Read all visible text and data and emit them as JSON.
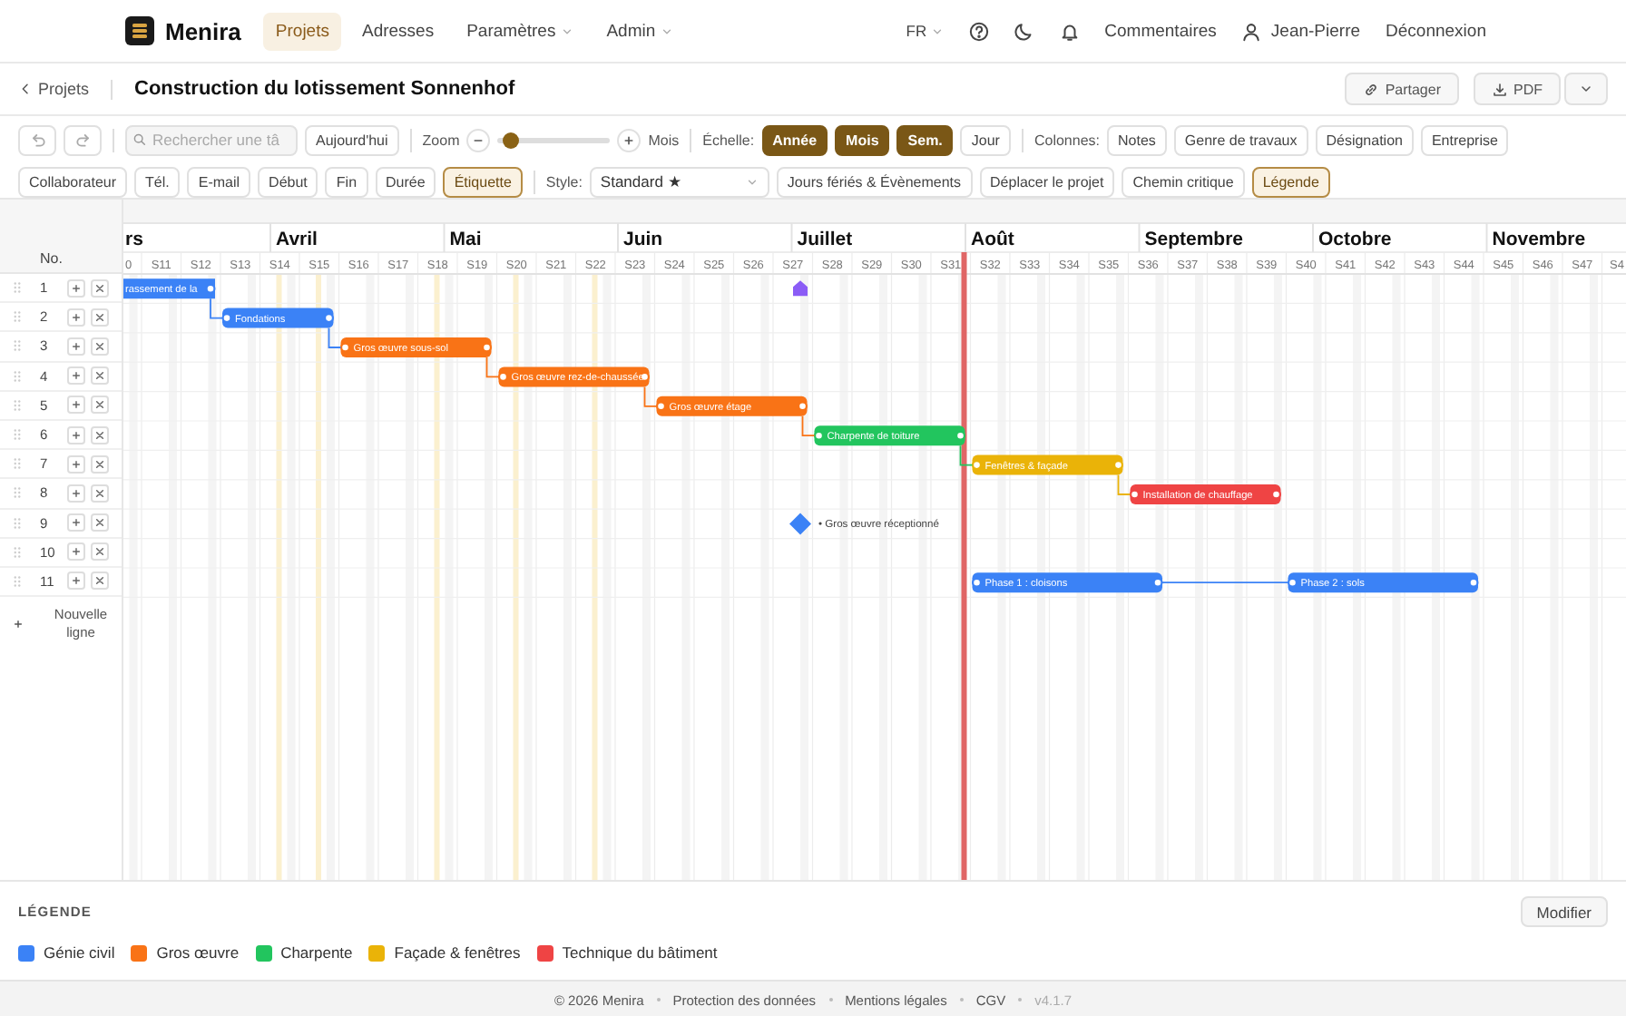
{
  "nav": {
    "brand": "Menira",
    "items": [
      {
        "label": "Projets",
        "selected": true,
        "menu": false
      },
      {
        "label": "Adresses",
        "selected": false,
        "menu": false
      },
      {
        "label": "Paramètres",
        "selected": false,
        "menu": true
      },
      {
        "label": "Admin",
        "selected": false,
        "menu": true
      }
    ],
    "language": "FR",
    "comments": "Commentaires",
    "user": "Jean-Pierre",
    "logout": "Déconnexion"
  },
  "project": {
    "back": "Projets",
    "title": "Construction du lotissement Sonnenhof",
    "actions": [
      {
        "kind": "share",
        "label": "Partager"
      },
      {
        "kind": "download",
        "label": "PDF"
      }
    ]
  },
  "toolbar": {
    "search": {
      "placeholder": "Rechercher une tâ"
    },
    "today": "Aujourd'hui",
    "zoom": {
      "label": "Zoom",
      "level": 0.05,
      "unit": "Mois"
    },
    "scale": {
      "label": "Échelle:",
      "options": [
        {
          "label": "Année",
          "selected": true
        },
        {
          "label": "Mois",
          "selected": true
        },
        {
          "label": "Sem.",
          "selected": true
        },
        {
          "label": "Jour",
          "selected": false
        }
      ]
    },
    "columns": {
      "label": "Colonnes:",
      "options": [
        {
          "label": "Notes",
          "on": false
        },
        {
          "label": "Genre de travaux",
          "on": false
        },
        {
          "label": "Désignation",
          "on": false
        },
        {
          "label": "Entreprise",
          "on": false
        }
      ]
    },
    "fields": [
      {
        "label": "Collaborateur",
        "on": false
      },
      {
        "label": "Tél.",
        "on": false
      },
      {
        "label": "E-mail",
        "on": false
      },
      {
        "label": "Début",
        "on": false
      },
      {
        "label": "Fin",
        "on": false
      },
      {
        "label": "Durée",
        "on": false
      },
      {
        "label": "Étiquette",
        "on": true
      }
    ],
    "style": {
      "label": "Style:",
      "value": "Standard ★"
    },
    "actions": [
      {
        "label": "Jours fériés & Évènements",
        "on": false
      },
      {
        "label": "Déplacer le projet",
        "on": false
      },
      {
        "label": "Chemin critique",
        "on": false
      },
      {
        "label": "Légende",
        "on": true
      }
    ]
  },
  "gantt": {
    "number_header": "No.",
    "months": [
      "rs",
      "Avril",
      "Mai",
      "Juin",
      "Juillet",
      "Août",
      "Septembre",
      "Octobre",
      "Novembre"
    ],
    "weeks": [
      "0",
      "S11",
      "S12",
      "S13",
      "S14",
      "S15",
      "S16",
      "S17",
      "S18",
      "S19",
      "S20",
      "S21",
      "S22",
      "S23",
      "S24",
      "S25",
      "S26",
      "S27",
      "S28",
      "S29",
      "S30",
      "S31",
      "S32",
      "S33",
      "S34",
      "S35",
      "S36",
      "S37",
      "S38",
      "S39",
      "S40",
      "S41",
      "S42",
      "S43",
      "S44",
      "S45",
      "S46",
      "S47",
      "S4"
    ],
    "rows": [
      {
        "number": "1",
        "items": [
          {
            "kind": "bar",
            "label": "rassement de la",
            "color": "#3b82f6",
            "linked": true
          },
          {
            "kind": "marker",
            "color": "#8b5cf6"
          }
        ]
      },
      {
        "number": "2",
        "items": [
          {
            "kind": "bar",
            "label": "Fondations",
            "color": "#3b82f6",
            "linked": true
          }
        ]
      },
      {
        "number": "3",
        "items": [
          {
            "kind": "bar",
            "label": "Gros œuvre sous-sol",
            "color": "#f97316",
            "linked": true
          }
        ]
      },
      {
        "number": "4",
        "items": [
          {
            "kind": "bar",
            "label": "Gros œuvre rez-de-chaussée",
            "color": "#f97316",
            "linked": true
          }
        ]
      },
      {
        "number": "5",
        "items": [
          {
            "kind": "bar",
            "label": "Gros œuvre étage",
            "color": "#f97316",
            "linked": true
          }
        ]
      },
      {
        "number": "6",
        "items": [
          {
            "kind": "bar",
            "label": "Charpente de toiture",
            "color": "#22c55e",
            "linked": true
          }
        ]
      },
      {
        "number": "7",
        "items": [
          {
            "kind": "bar",
            "label": "Fenêtres & façade",
            "color": "#eab308",
            "linked": true
          }
        ]
      },
      {
        "number": "8",
        "items": [
          {
            "kind": "bar",
            "label": "Installation de chauffage",
            "color": "#ef4444",
            "linked": false
          }
        ]
      },
      {
        "number": "9",
        "items": [
          {
            "kind": "milestone",
            "label": "• Gros œuvre réceptionné",
            "color": "#3b82f6"
          }
        ]
      },
      {
        "number": "10",
        "items": []
      },
      {
        "number": "11",
        "items": [
          {
            "kind": "bar",
            "label": "Phase 1 : cloisons",
            "color": "#3b82f6",
            "linked": true
          },
          {
            "kind": "bar",
            "label": "Phase 2 : sols",
            "color": "#3b82f6"
          }
        ]
      }
    ],
    "new_row": "Nouvelle ligne"
  },
  "legend": {
    "title": "LÉGENDE",
    "edit": "Modifier",
    "items": [
      {
        "label": "Génie civil",
        "color": "#3b82f6"
      },
      {
        "label": "Gros œuvre",
        "color": "#f97316"
      },
      {
        "label": "Charpente",
        "color": "#22c55e"
      },
      {
        "label": "Façade & fenêtres",
        "color": "#eab308"
      },
      {
        "label": "Technique du bâtiment",
        "color": "#ef4444"
      }
    ]
  },
  "footer": {
    "items": [
      {
        "kind": "text",
        "label": "© 2026 Menira"
      },
      {
        "kind": "link",
        "label": "Protection des données"
      },
      {
        "kind": "link",
        "label": "Mentions légales"
      },
      {
        "kind": "link",
        "label": "CGV"
      },
      {
        "kind": "version",
        "label": "v4.1.7"
      }
    ]
  }
}
